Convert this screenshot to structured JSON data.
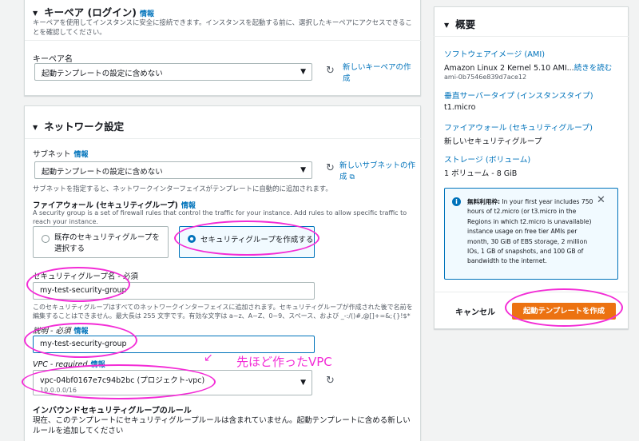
{
  "keypair": {
    "title": "キーペア (ログイン)",
    "info": "情報",
    "desc": "キーペアを使用してインスタンスに安全に接続できます。インスタンスを起動する前に、選択したキーペアにアクセスできることを確認してください。",
    "name_label": "キーペア名",
    "select_value": "起動テンプレートの設定に含めない",
    "new_link": "新しいキーペアの作成"
  },
  "network": {
    "title": "ネットワーク設定",
    "subnet_label": "サブネット",
    "subnet_info": "情報",
    "subnet_value": "起動テンプレートの設定に含めない",
    "new_subnet_link": "新しいサブネットの作成",
    "subnet_help": "サブネットを指定すると、ネットワークインターフェイスがテンプレートに自動的に追加されます。",
    "firewall_label": "ファイアウォール (セキュリティグループ)",
    "firewall_info": "情報",
    "firewall_desc": "A security group is a set of firewall rules that control the traffic for your instance. Add rules to allow specific traffic to reach your instance.",
    "option_existing": "既存のセキュリティグループを選択する",
    "option_create": "セキュリティグループを作成する",
    "sg_name_label": "セキュリティグループ名 - 必須",
    "sg_name_value": "my-test-security-group",
    "sg_name_help": "このセキュリティグループはすべてのネットワークインターフェイスに追加されます。セキュリティグループが作成された後で名前を編集することはできません。最大長は 255 文字です。有効な文字は a~z、A~Z、0~9、スペース、および _-:/()#,@[]+=&;{}!$*",
    "desc_label": "説明 - 必須",
    "desc_info": "情報",
    "desc_value": "my-test-security-group",
    "vpc_label": "VPC - required",
    "vpc_info": "情報",
    "vpc_value": "vpc-04bf0167e7c94b2bc (プロジェクト-vpc)",
    "vpc_cidr": "10.0.0.0/16",
    "annotation": "先ほど作ったVPC",
    "inbound_title": "インバウンドセキュリティグループのルール",
    "inbound_desc": "現在、このテンプレートにセキュリティグループルールは含まれていません。起動テンプレートに含める新しいルールを追加してください"
  },
  "summary": {
    "title": "概要",
    "ami_label": "ソフトウェアイメージ (AMI)",
    "ami_value": "Amazon Linux 2 Kernel 5.10 AMI...",
    "ami_more": "続きを読む",
    "ami_id": "ami-0b7546e839d7ace12",
    "instance_label": "垂直サーバータイプ (インスタンスタイプ)",
    "instance_value": "t1.micro",
    "firewall_label": "ファイアウォール (セキュリティグループ)",
    "firewall_value": "新しいセキュリティグループ",
    "storage_label": "ストレージ (ボリューム)",
    "storage_value": "1 ボリューム - 8 GiB",
    "free_tier_bold": "無料利用枠:",
    "free_tier_text": " In your first year includes 750 hours of t2.micro (or t3.micro in the Regions in which t2.micro is unavailable) instance usage on free tier AMIs per month, 30 GiB of EBS storage, 2 million IOs, 1 GB of snapshots, and 100 GB of bandwidth to the internet.",
    "cancel": "キャンセル",
    "create": "起動テンプレートを作成"
  },
  "colors": {
    "accent": "#0073bb",
    "primary_button": "#ec7211",
    "annotation": "#f32cd6",
    "info_box_bg": "#f1faff"
  }
}
